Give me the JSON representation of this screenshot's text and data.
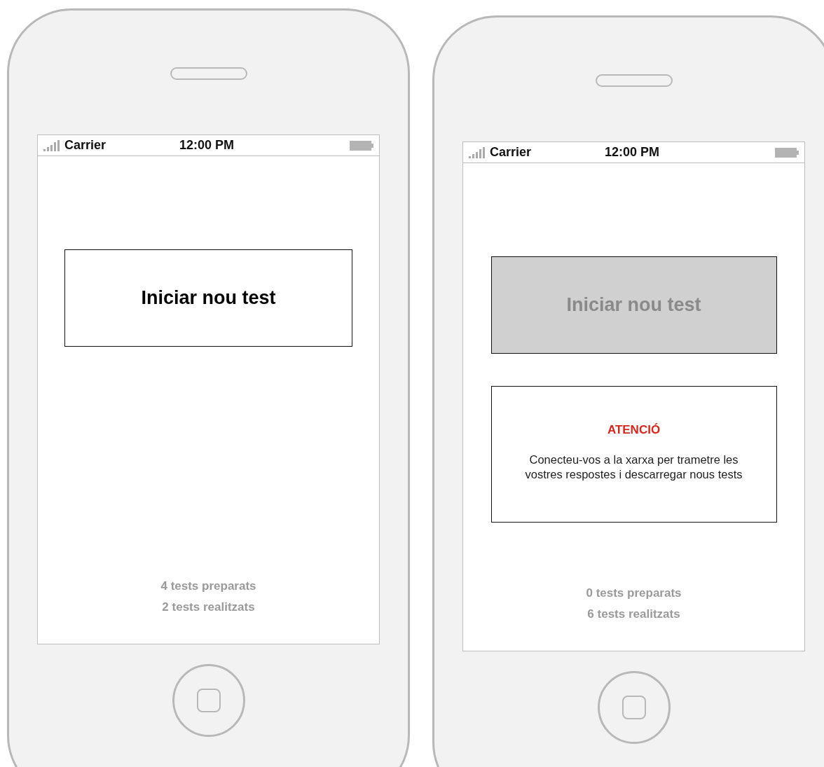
{
  "phones": [
    {
      "status_bar": {
        "carrier": "Carrier",
        "time": "12:00 PM"
      },
      "start_button": {
        "label": "Iniciar nou test",
        "disabled": false
      },
      "counts": [
        "4 tests preparats",
        "2 tests realitzats"
      ]
    },
    {
      "status_bar": {
        "carrier": "Carrier",
        "time": "12:00 PM"
      },
      "start_button": {
        "label": "Iniciar nou test",
        "disabled": true
      },
      "alert": {
        "title": "ATENCIÓ",
        "message": "Conecteu-vos a la xarxa per trametre les vostres respostes i descarregar nous tests"
      },
      "counts": [
        "0 tests preparats",
        "6 tests realitzats"
      ]
    }
  ]
}
